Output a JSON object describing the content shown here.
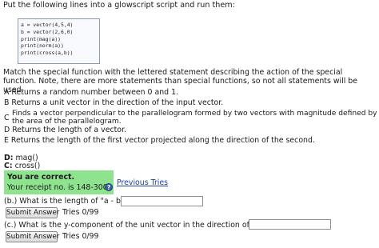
{
  "instructions": "Put the following lines into a glowscript script and run them:",
  "code_lines": [
    "a = vector(4,5,4)",
    "b = vector(2,6,0)",
    "print(mag(a))",
    "print(norm(a))",
    "print(cross(a,b))"
  ],
  "matching_instructions": "Match the special function with the lettered statement describing the action of the special function. Note, there are more statements than special functions, so not all statements will be used.",
  "statements": {
    "A": "A Returns a random number between 0 and 1.",
    "B": "B Returns a unit vector in the direction of the input vector.",
    "C_letter": "C",
    "C_text": "Finds a vector perpendicular to the parallelogram formed by two vectors with magnitude defined by the area of the parallelogram.",
    "D": "D Returns the length of a vector.",
    "E": "E Returns the length of the first vector projected along the direction of the second."
  },
  "answers": {
    "line1_letter": "D:",
    "line1_func": "mag()",
    "line2_letter": "C:",
    "line2_func": "cross()"
  },
  "feedback": {
    "status": "You are correct.",
    "receipt": "Your receipt no. is 148-300",
    "help_glyph": "?",
    "previous_tries": "Previous Tries"
  },
  "part_b": {
    "question": "(b.) What is the length of \"a - b\"?",
    "input_value": "",
    "submit_label": "Submit Answer",
    "tries": "Tries 0/99"
  },
  "part_c": {
    "question": "(c.) What is the y-component of the unit vector in the direction of a - b?",
    "input_value": "",
    "submit_label": "Submit Answer",
    "tries": "Tries 0/99"
  }
}
